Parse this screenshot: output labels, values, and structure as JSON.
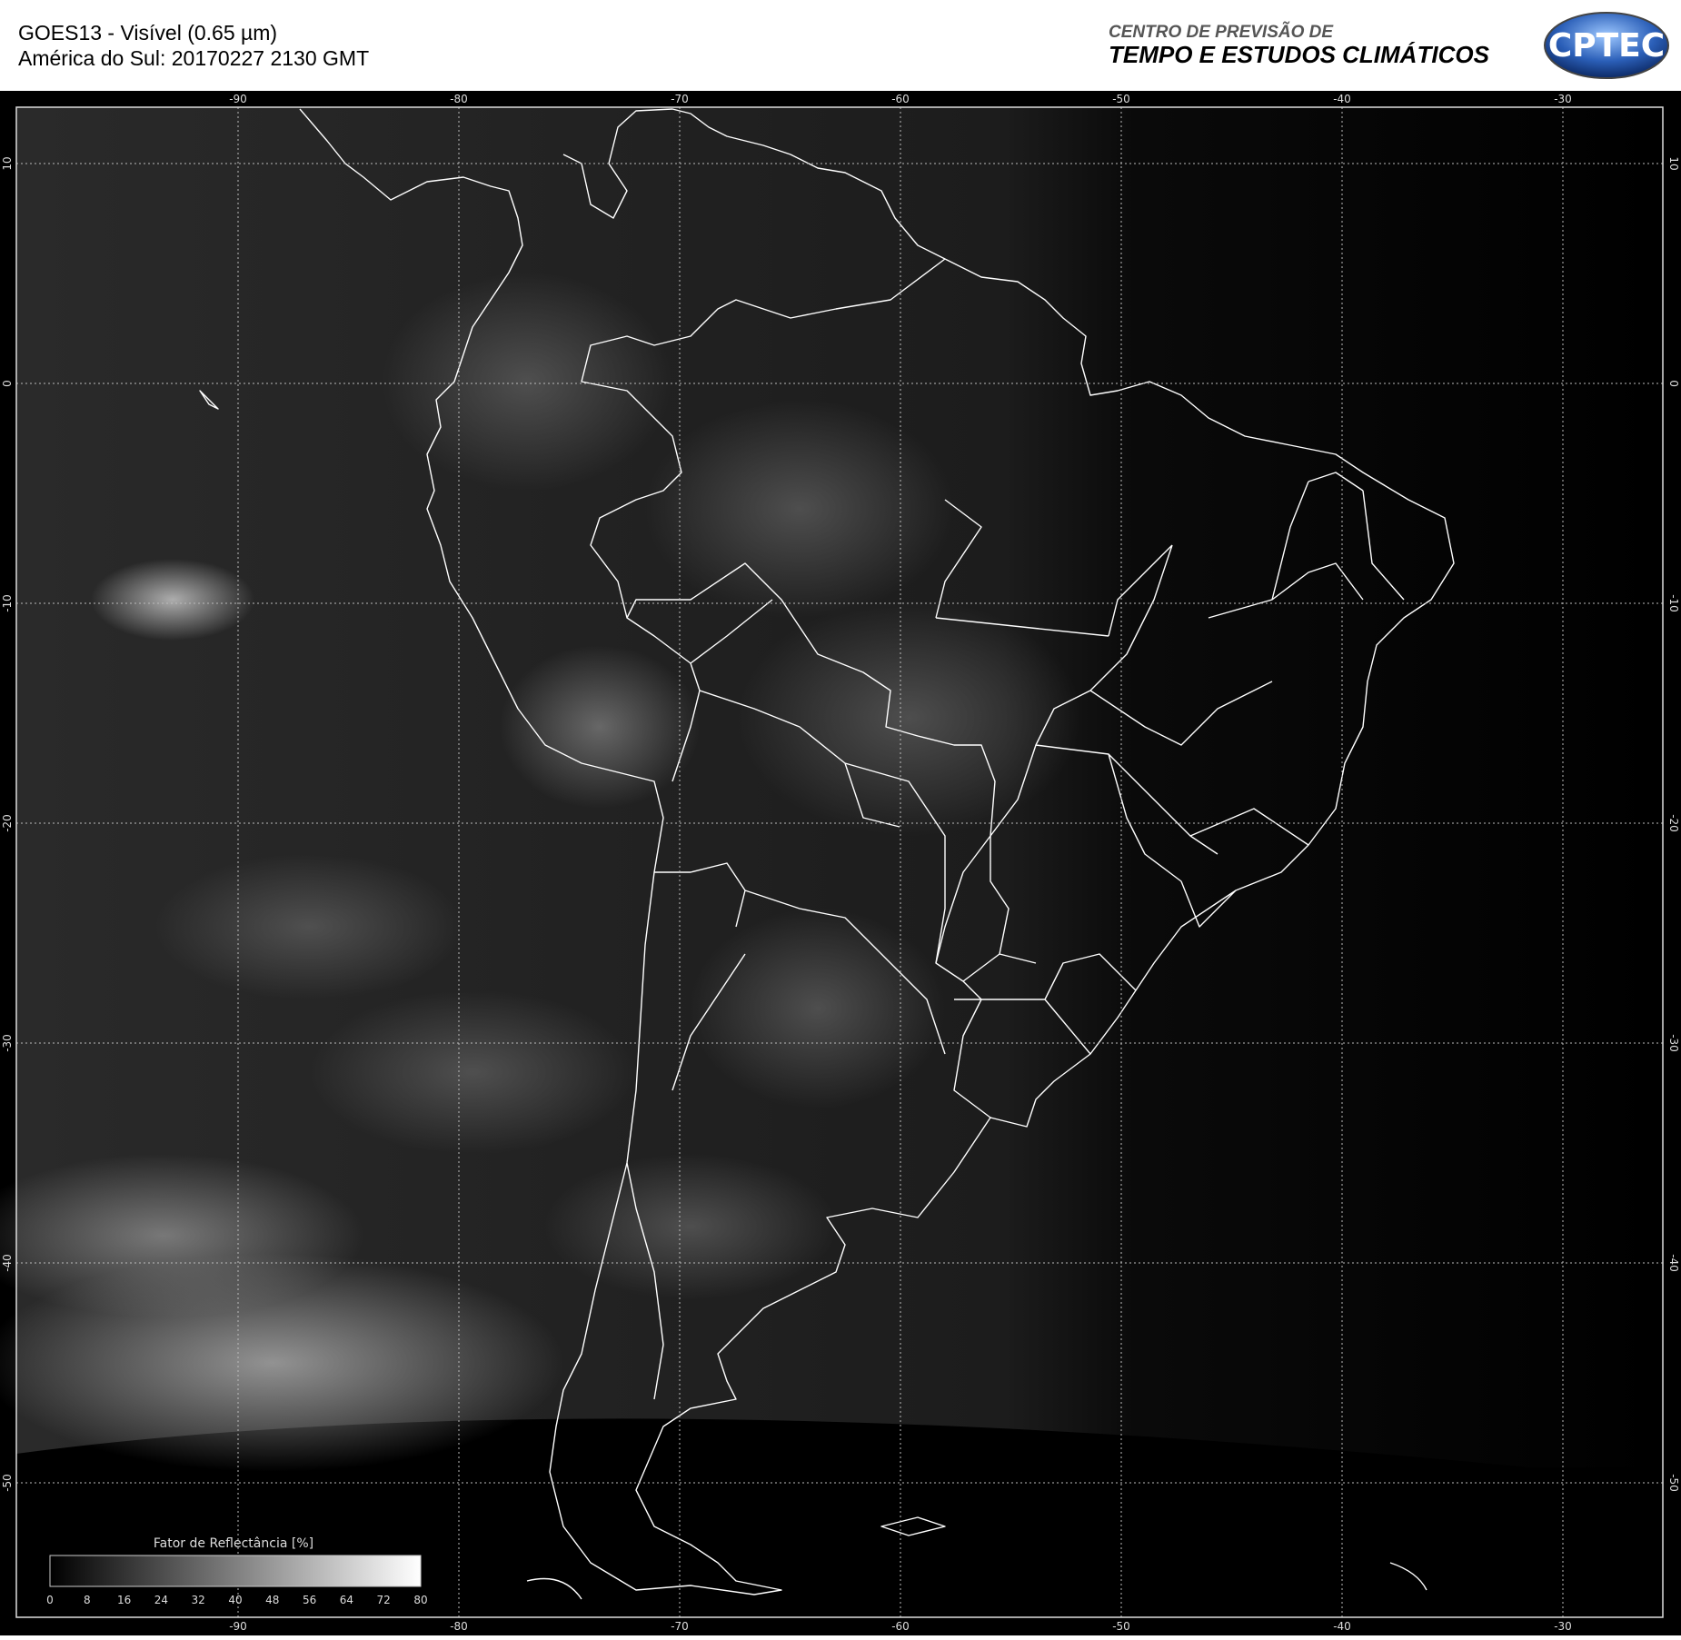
{
  "header": {
    "title_line1": "GOES13 - Visível (0.65 µm)",
    "title_line2": "América do Sul: 20170227 2130 GMT",
    "org_line1": "CENTRO DE PREVISÃO DE",
    "org_line2": "TEMPO E ESTUDOS CLIMÁTICOS",
    "logo_text": "CPTEC"
  },
  "map": {
    "lon_ticks": [
      "-90",
      "-80",
      "-70",
      "-60",
      "-50",
      "-40",
      "-30"
    ],
    "lat_ticks": [
      "10",
      "0",
      "-10",
      "-20",
      "-30",
      "-40",
      "-50"
    ]
  },
  "colorbar": {
    "title": "Fator de Reflectância [%]",
    "ticks": [
      "0",
      "8",
      "16",
      "24",
      "32",
      "40",
      "48",
      "56",
      "64",
      "72",
      "80"
    ]
  },
  "colors": {
    "map_background": "#000000",
    "grid": "#bbbbbb",
    "border_lines": "#ffffff"
  }
}
